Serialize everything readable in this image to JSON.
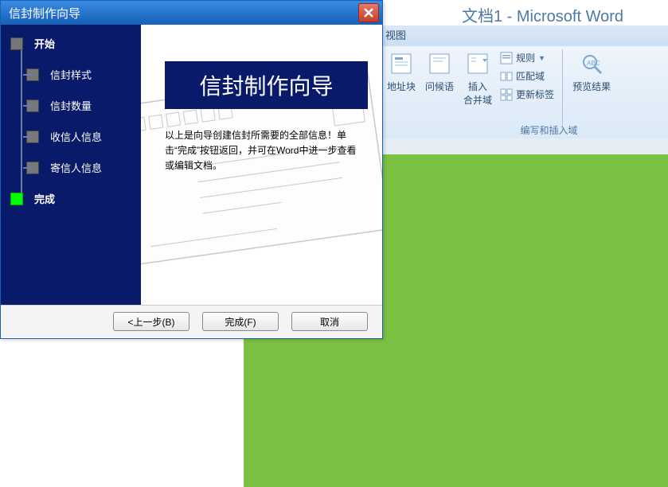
{
  "word": {
    "title": "文档1 - Microsoft Word",
    "tab_view": "视图",
    "ribbon": {
      "address_block": "地址块",
      "greeting": "问候语",
      "insert_merge": "插入\n合并域",
      "rules": "规则",
      "match_fields": "匹配域",
      "update_labels": "更新标签",
      "preview": "预览结果",
      "group": "编写和插入域"
    }
  },
  "dialog": {
    "title": "信封制作向导",
    "nav": {
      "start": "开始",
      "style": "信封样式",
      "count": "信封数量",
      "recipient": "收信人信息",
      "sender": "寄信人信息",
      "finish": "完成"
    },
    "content_title": "信封制作向导",
    "content_text": "以上是向导创建信封所需要的全部信息！单击“完成”按钮返回，并可在Word中进一步查看或编辑文档。",
    "buttons": {
      "prev": "<上一步(B)",
      "finish": "完成(F)",
      "cancel": "取消"
    }
  }
}
